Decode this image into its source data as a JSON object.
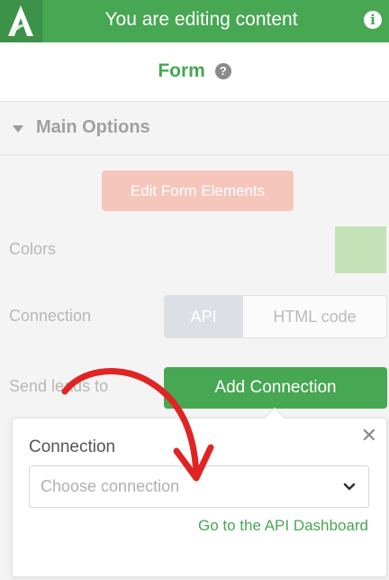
{
  "topbar": {
    "title": "You are editing content",
    "info_icon": "info-icon",
    "logo_icon": "brand-logo",
    "color": "#47a753"
  },
  "header": {
    "title": "Form",
    "help_icon": "question-icon"
  },
  "section": {
    "title": "Main Options",
    "collapse_icon": "caret-down-icon"
  },
  "edit_button": {
    "label": "Edit Form Elements",
    "color": "#f6c6bd"
  },
  "colors": {
    "label": "Colors",
    "swatch": "#c4e2b8"
  },
  "connection": {
    "label": "Connection",
    "options": [
      "API",
      "HTML code"
    ],
    "selected": "API"
  },
  "send_leads": {
    "label": "Send leads to",
    "button_label": "Add Connection"
  },
  "popup": {
    "label": "Connection",
    "select_placeholder": "Choose connection",
    "link_label": "Go to the API Dashboard",
    "close_icon": "close-icon",
    "chevron_icon": "chevron-down-icon"
  },
  "annotation": {
    "icon": "red-arrow",
    "color": "#e02424"
  }
}
